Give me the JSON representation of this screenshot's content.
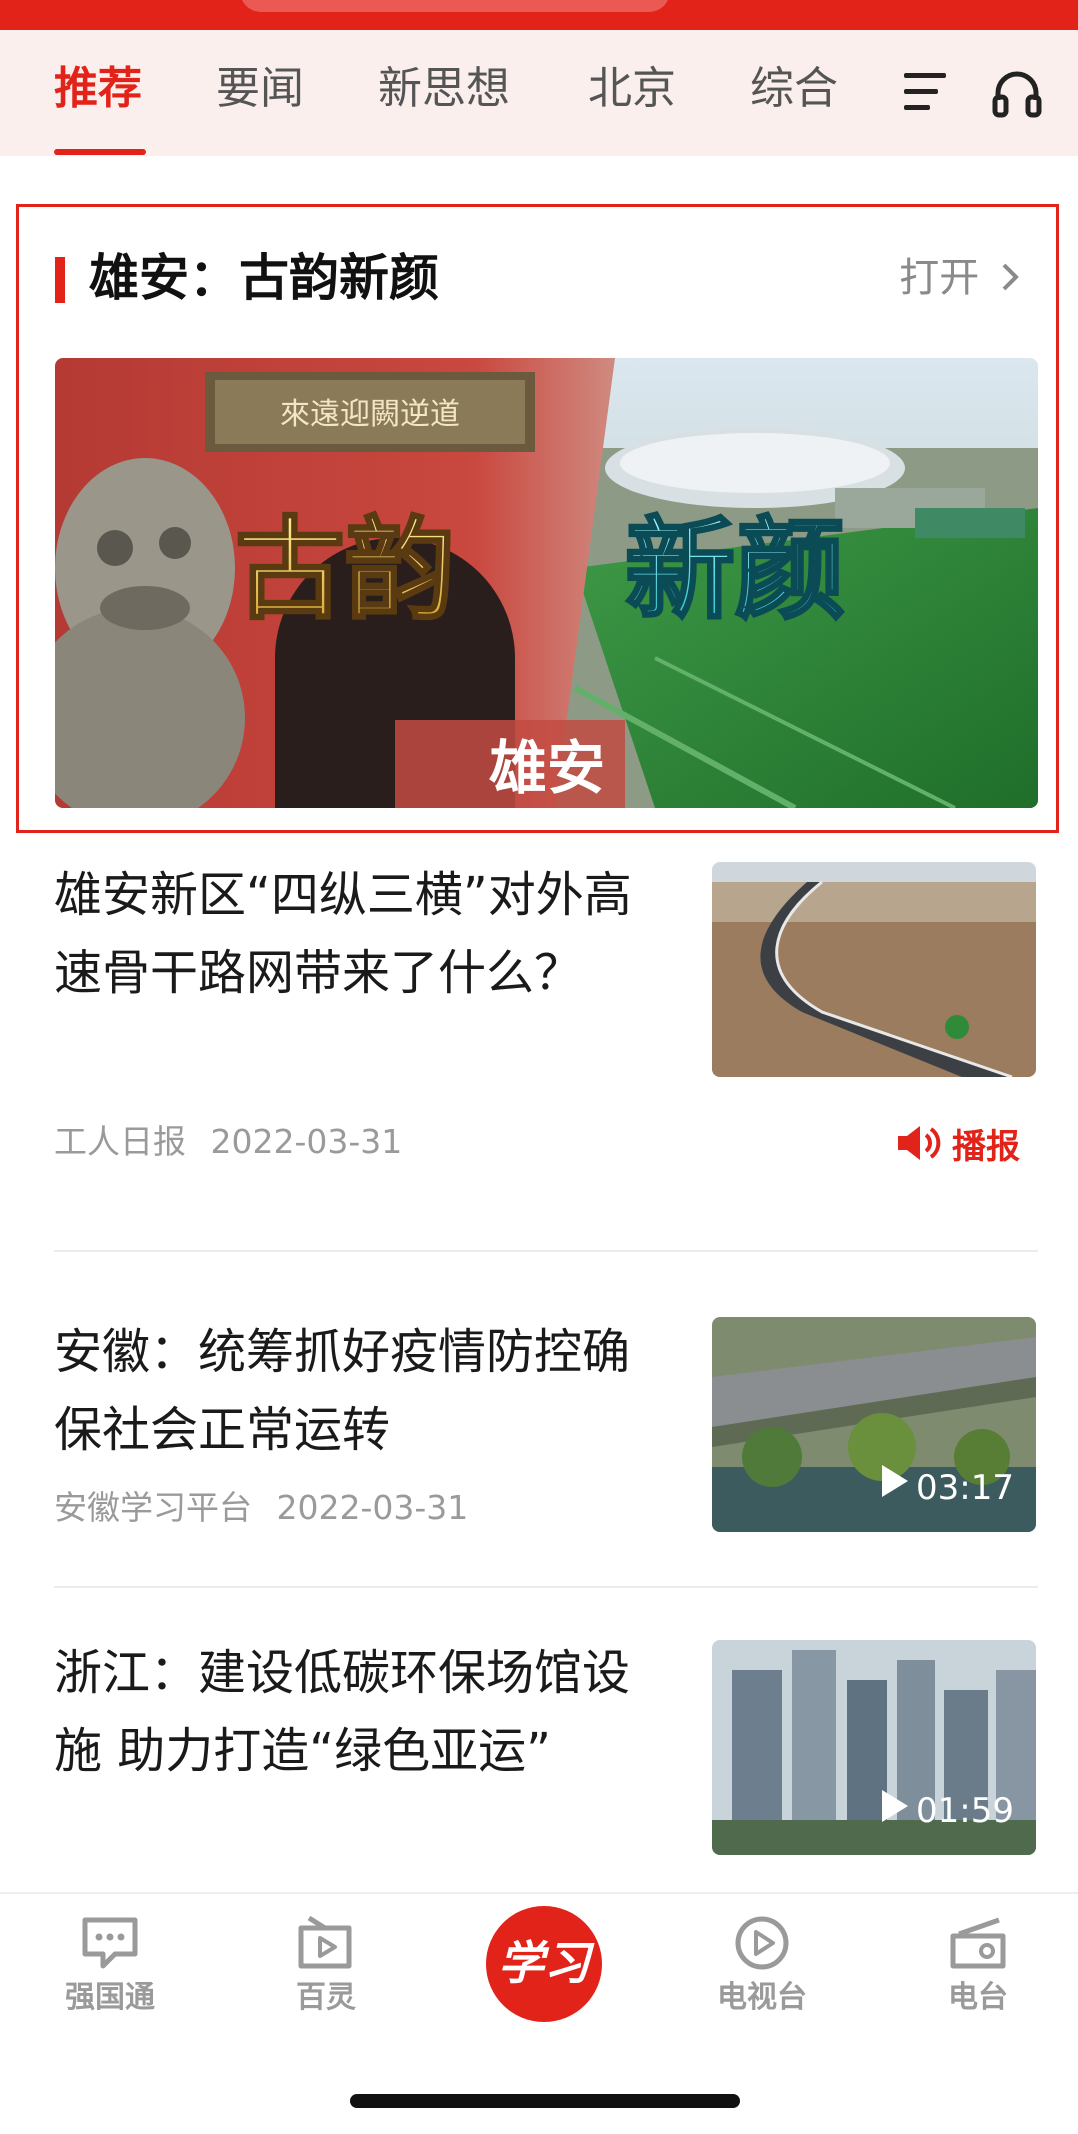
{
  "tabs": {
    "items": [
      {
        "label": "推荐",
        "active": true
      },
      {
        "label": "要闻",
        "active": false
      },
      {
        "label": "新思想",
        "active": false
      },
      {
        "label": "北京",
        "active": false
      },
      {
        "label": "综合",
        "active": false
      }
    ],
    "menu_icon": "menu-icon",
    "audio_icon": "headphones-icon"
  },
  "feature": {
    "title": "雄安：古韵新颜",
    "open_label": "打开",
    "banner": {
      "plaque_text": "來遠迎闕逆道",
      "text_left": "古韵",
      "text_right": "新颜",
      "text_bottom": "雄安"
    }
  },
  "news": [
    {
      "title": "雄安新区“四纵三横”对外高速骨干路网带来了什么？",
      "source": "工人日报",
      "date": "2022-03-31",
      "action": {
        "label": "播报",
        "icon": "speaker-icon"
      }
    },
    {
      "title": "安徽：统筹抓好疫情防控确保社会正常运转",
      "source": "安徽学习平台",
      "date": "2022-03-31",
      "duration": "03:17"
    },
    {
      "title": "浙江：建设低碳环保场馆设施 助力打造“绿色亚运”",
      "duration": "01:59"
    }
  ],
  "bottom_nav": {
    "items": [
      {
        "label": "强国通",
        "icon": "chat-icon"
      },
      {
        "label": "百灵",
        "icon": "video-play-icon"
      },
      {
        "label": "学习",
        "icon": "xuexi-logo",
        "center": true
      },
      {
        "label": "电视台",
        "icon": "tv-play-icon"
      },
      {
        "label": "电台",
        "icon": "radio-icon"
      }
    ]
  },
  "colors": {
    "accent": "#e2231a",
    "tab_bar_bg": "#fbefed",
    "meta_gray": "#9a9a9a"
  }
}
